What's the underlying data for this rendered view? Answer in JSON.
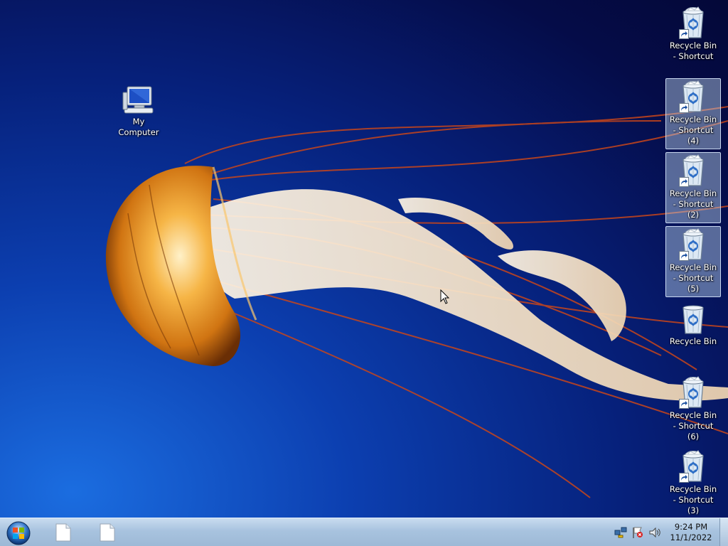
{
  "desktop": {
    "icons": [
      {
        "label": "My Computer",
        "type": "computer",
        "shortcut": false,
        "selected": false
      },
      {
        "label": "Recycle Bin - Shortcut",
        "type": "recycle",
        "shortcut": true,
        "selected": false
      },
      {
        "label": "Recycle Bin - Shortcut (4)",
        "type": "recycle",
        "shortcut": true,
        "selected": true
      },
      {
        "label": "Recycle Bin - Shortcut (2)",
        "type": "recycle",
        "shortcut": true,
        "selected": true
      },
      {
        "label": "Recycle Bin - Shortcut (5)",
        "type": "recycle",
        "shortcut": true,
        "selected": true
      },
      {
        "label": "Recycle Bin",
        "type": "recycle-empty",
        "shortcut": false,
        "selected": false
      },
      {
        "label": "Recycle Bin - Shortcut (6)",
        "type": "recycle",
        "shortcut": true,
        "selected": false
      },
      {
        "label": "Recycle Bin - Shortcut (3)",
        "type": "recycle",
        "shortcut": true,
        "selected": false
      }
    ],
    "wallpaper": "jellyfish"
  },
  "taskbar": {
    "start_icon": "windows-orb-icon",
    "buttons": [
      {
        "icon": "blank-document-icon"
      },
      {
        "icon": "blank-document-icon"
      }
    ],
    "tray": {
      "icons": [
        "network-icon",
        "action-center-flag-icon",
        "volume-icon"
      ],
      "time": "9:24 PM",
      "date": "11/1/2022"
    }
  },
  "colors": {
    "taskbar": "#a8c3df",
    "selection": "#bed7f0",
    "wallpaper_deep": "#050c48",
    "wallpaper_light": "#1b6de0"
  }
}
